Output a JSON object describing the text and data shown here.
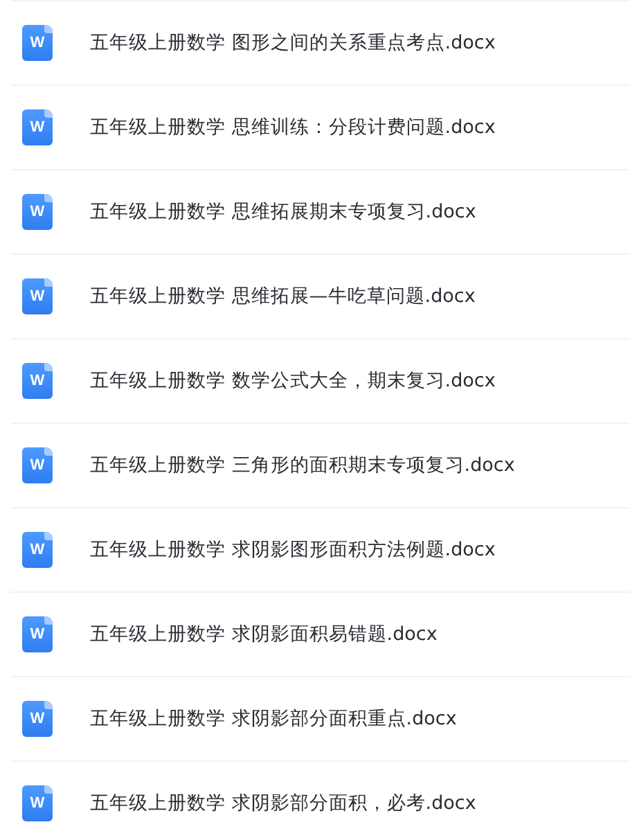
{
  "files": [
    {
      "icon_label": "W",
      "name": "五年级上册数学 图形之间的关系重点考点.docx"
    },
    {
      "icon_label": "W",
      "name": "五年级上册数学 思维训练：分段计费问题.docx"
    },
    {
      "icon_label": "W",
      "name": "五年级上册数学 思维拓展期末专项复习.docx"
    },
    {
      "icon_label": "W",
      "name": "五年级上册数学 思维拓展—牛吃草问题.docx"
    },
    {
      "icon_label": "W",
      "name": "五年级上册数学 数学公式大全，期末复习.docx"
    },
    {
      "icon_label": "W",
      "name": "五年级上册数学 三角形的面积期末专项复习.docx"
    },
    {
      "icon_label": "W",
      "name": "五年级上册数学 求阴影图形面积方法例题.docx"
    },
    {
      "icon_label": "W",
      "name": "五年级上册数学 求阴影面积易错题.docx"
    },
    {
      "icon_label": "W",
      "name": "五年级上册数学 求阴影部分面积重点.docx"
    },
    {
      "icon_label": "W",
      "name": "五年级上册数学 求阴影部分面积，必考.docx"
    }
  ]
}
